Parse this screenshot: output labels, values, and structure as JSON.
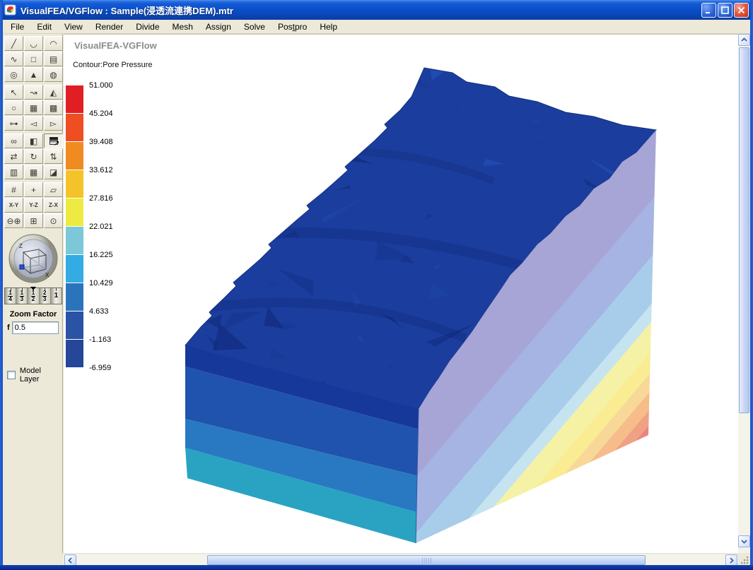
{
  "window": {
    "title": "VisualFEA/VGFlow :  Sample(浸透流連携DEM).mtr",
    "controls": {
      "minimize": "minimize",
      "maximize": "maximize",
      "close": "close"
    }
  },
  "menu": {
    "items": [
      {
        "label": "File"
      },
      {
        "label": "Edit"
      },
      {
        "label": "View"
      },
      {
        "label": "Render"
      },
      {
        "label": "Divide"
      },
      {
        "label": "Mesh"
      },
      {
        "label": "Assign"
      },
      {
        "label": "Solve"
      },
      {
        "label": "Postpro",
        "accel": "t"
      },
      {
        "label": "Help"
      }
    ]
  },
  "toolbar": {
    "groups": [
      [
        {
          "name": "draw-line",
          "glyph": "╱"
        },
        {
          "name": "draw-arc",
          "glyph": "◡"
        },
        {
          "name": "draw-curve",
          "glyph": "◠"
        },
        {
          "name": "draw-spline",
          "glyph": "∿"
        },
        {
          "name": "draw-rectangle",
          "glyph": "□"
        },
        {
          "name": "draw-surface",
          "glyph": "▤"
        },
        {
          "name": "draw-circle",
          "glyph": "◎"
        },
        {
          "name": "draw-cone",
          "glyph": "▲"
        },
        {
          "name": "draw-disc",
          "glyph": "◍"
        }
      ],
      [
        {
          "name": "select-node",
          "glyph": "↖"
        },
        {
          "name": "select-curve",
          "glyph": "↝"
        },
        {
          "name": "select-surface",
          "glyph": "◭"
        },
        {
          "name": "select-lasso",
          "glyph": "○"
        },
        {
          "name": "select-mesh",
          "glyph": "▦"
        },
        {
          "name": "select-volume",
          "glyph": "▩"
        },
        {
          "name": "select-point",
          "glyph": "⊶"
        },
        {
          "name": "select-face",
          "glyph": "◅"
        },
        {
          "name": "select-element",
          "glyph": "▻"
        }
      ],
      [
        {
          "name": "profile-curve",
          "glyph": "∞"
        },
        {
          "name": "shade-surface",
          "glyph": "◧"
        },
        {
          "name": "contour-tool",
          "glyph": "",
          "special": "contour",
          "active": true
        },
        {
          "name": "extrude-cube",
          "glyph": "⇄"
        },
        {
          "name": "rotate-cube",
          "glyph": "↻"
        },
        {
          "name": "pan-cube",
          "glyph": "⇅"
        },
        {
          "name": "stripe-cube",
          "glyph": "▥"
        },
        {
          "name": "hatch-cube",
          "glyph": "▦"
        },
        {
          "name": "cut-cube",
          "glyph": "◪"
        }
      ],
      [
        {
          "name": "mesh-edit",
          "glyph": "#"
        },
        {
          "name": "mesh-move",
          "glyph": "+"
        },
        {
          "name": "box-wireframe",
          "glyph": "▱"
        },
        {
          "name": "plane-xy",
          "glyph": "X-Y",
          "small": true
        },
        {
          "name": "plane-yz",
          "glyph": "Y-Z",
          "small": true
        },
        {
          "name": "plane-zx",
          "glyph": "Z-X",
          "small": true
        },
        {
          "name": "zoom-in-out",
          "glyph": "⊖⊕"
        },
        {
          "name": "fit-view",
          "glyph": "⊞"
        },
        {
          "name": "center-view",
          "glyph": "⊙"
        }
      ]
    ]
  },
  "viewport": {
    "heading": "VisualFEA-VGFlow",
    "contour_label": "Contour:Pore Pressure"
  },
  "legend": {
    "values": [
      "51.000",
      "45.204",
      "39.408",
      "33.612",
      "27.816",
      "22.021",
      "16.225",
      "10.429",
      "4.633",
      "-1.163",
      "-6.959"
    ],
    "colors": [
      "#e01f25",
      "#ef4e22",
      "#f08b21",
      "#f4c329",
      "#eeea41",
      "#7cc7d8",
      "#32ace2",
      "#2b74bb",
      "#2a53a6",
      "#26469a"
    ]
  },
  "view_controls": {
    "zoom_factor_label": "Zoom Factor",
    "field_label": "f",
    "zoom_value": "0.5",
    "fractions": [
      [
        "1",
        "4"
      ],
      [
        "1",
        "3"
      ],
      [
        "1",
        "2"
      ],
      [
        "2",
        "3"
      ],
      [
        "1",
        ""
      ]
    ],
    "axis_labels": {
      "up": "Z",
      "right": "X"
    }
  },
  "model_layer": {
    "label": "Model Layer",
    "checked": false
  },
  "model": {
    "terrain_color": "#1b3e9e",
    "facet_colors": [
      "#122c80",
      "#16368f",
      "#1e47ac",
      "#2250b8",
      "#0f2875"
    ],
    "front_bands": [
      "#17389b",
      "#1f53ae",
      "#2879c2",
      "#2aa3c2"
    ],
    "cut_bands": [
      "#a7a4d6",
      "#a5b4e2",
      "#a8cdea",
      "#c6e3f0",
      "#f5f2a6",
      "#f9ec92",
      "#f8d898",
      "#f6bd8b",
      "#f1a183",
      "#eb8481"
    ],
    "cut_band_stops": [
      0,
      0.22,
      0.41,
      0.57,
      0.63,
      0.73,
      0.8,
      0.86,
      0.92,
      0.97,
      1
    ],
    "edge_color": "#13307f"
  }
}
